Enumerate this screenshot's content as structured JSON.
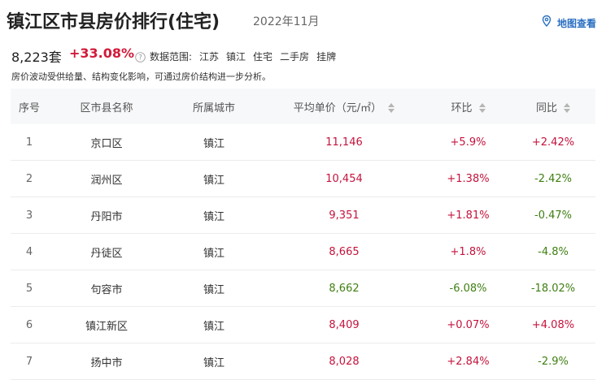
{
  "header": {
    "title": "镇江区市县房价排行(住宅)",
    "date": "2022年11月",
    "map_link": "地图查看",
    "map_icon": "map-pin-icon"
  },
  "summary": {
    "price": "8,223套",
    "change": "+33.08%",
    "scope_label": "数据范围:",
    "scope_items": [
      "江苏",
      "镇江",
      "住宅",
      "二手房",
      "挂牌"
    ],
    "note": "房价波动受供给量、结构变化影响，可通过房价结构进一步分析。"
  },
  "colors": {
    "up": "#c4133c",
    "down": "#3f7f12",
    "accent": "#2a6fc1"
  },
  "table": {
    "headers": [
      "序号",
      "区市县名称",
      "所属城市",
      "平均单价（元/㎡）",
      "环比",
      "同比"
    ],
    "rows": [
      {
        "rank": "1",
        "name": "京口区",
        "city": "镇江",
        "price": "11,146",
        "price_trend": "up",
        "mom": "+5.9%",
        "mom_trend": "up",
        "yoy": "+2.42%",
        "yoy_trend": "up"
      },
      {
        "rank": "2",
        "name": "润州区",
        "city": "镇江",
        "price": "10,454",
        "price_trend": "up",
        "mom": "+1.38%",
        "mom_trend": "up",
        "yoy": "-2.42%",
        "yoy_trend": "down"
      },
      {
        "rank": "3",
        "name": "丹阳市",
        "city": "镇江",
        "price": "9,351",
        "price_trend": "up",
        "mom": "+1.81%",
        "mom_trend": "up",
        "yoy": "-0.47%",
        "yoy_trend": "down"
      },
      {
        "rank": "4",
        "name": "丹徒区",
        "city": "镇江",
        "price": "8,665",
        "price_trend": "up",
        "mom": "+1.8%",
        "mom_trend": "up",
        "yoy": "-4.8%",
        "yoy_trend": "down"
      },
      {
        "rank": "5",
        "name": "句容市",
        "city": "镇江",
        "price": "8,662",
        "price_trend": "down",
        "mom": "-6.08%",
        "mom_trend": "down",
        "yoy": "-18.02%",
        "yoy_trend": "down"
      },
      {
        "rank": "6",
        "name": "镇江新区",
        "city": "镇江",
        "price": "8,409",
        "price_trend": "up",
        "mom": "+0.07%",
        "mom_trend": "up",
        "yoy": "+4.08%",
        "yoy_trend": "up"
      },
      {
        "rank": "7",
        "name": "扬中市",
        "city": "镇江",
        "price": "8,028",
        "price_trend": "up",
        "mom": "+2.84%",
        "mom_trend": "up",
        "yoy": "-2.9%",
        "yoy_trend": "down"
      }
    ]
  }
}
